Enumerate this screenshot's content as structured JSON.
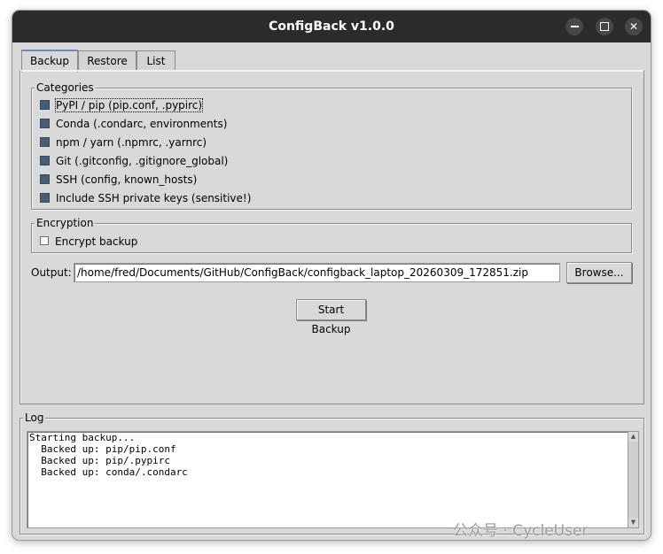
{
  "window": {
    "title": "ConfigBack v1.0.0"
  },
  "tabs": [
    {
      "label": "Backup",
      "active": true
    },
    {
      "label": "Restore",
      "active": false
    },
    {
      "label": "List",
      "active": false
    }
  ],
  "categories": {
    "legend": "Categories",
    "items": [
      {
        "label": "PyPI / pip  (pip.conf, .pypirc)",
        "checked": true
      },
      {
        "label": "Conda  (.condarc, environments)",
        "checked": true
      },
      {
        "label": "npm / yarn  (.npmrc, .yarnrc)",
        "checked": true
      },
      {
        "label": "Git  (.gitconfig, .gitignore_global)",
        "checked": true
      },
      {
        "label": "SSH  (config, known_hosts)",
        "checked": true
      },
      {
        "label": "Include SSH private keys (sensitive!)",
        "checked": true
      }
    ]
  },
  "encryption": {
    "legend": "Encryption",
    "option_label": "Encrypt backup",
    "checked": false
  },
  "output": {
    "label": "Output:",
    "value": "/home/fred/Documents/GitHub/ConfigBack/configback_laptop_20260309_172851.zip",
    "browse_label": "Browse..."
  },
  "start_button_label": "Start Backup",
  "log": {
    "legend": "Log",
    "lines": [
      "Starting backup...",
      "  Backed up: pip/pip.conf",
      "  Backed up: pip/.pypirc",
      "  Backed up: conda/.condarc"
    ]
  },
  "watermark": "公众号 · CycleUser",
  "colors": {
    "titlebar": "#2b2b2b",
    "window_bg": "#d9d9d9",
    "checkbox_fill": "#485c73"
  }
}
